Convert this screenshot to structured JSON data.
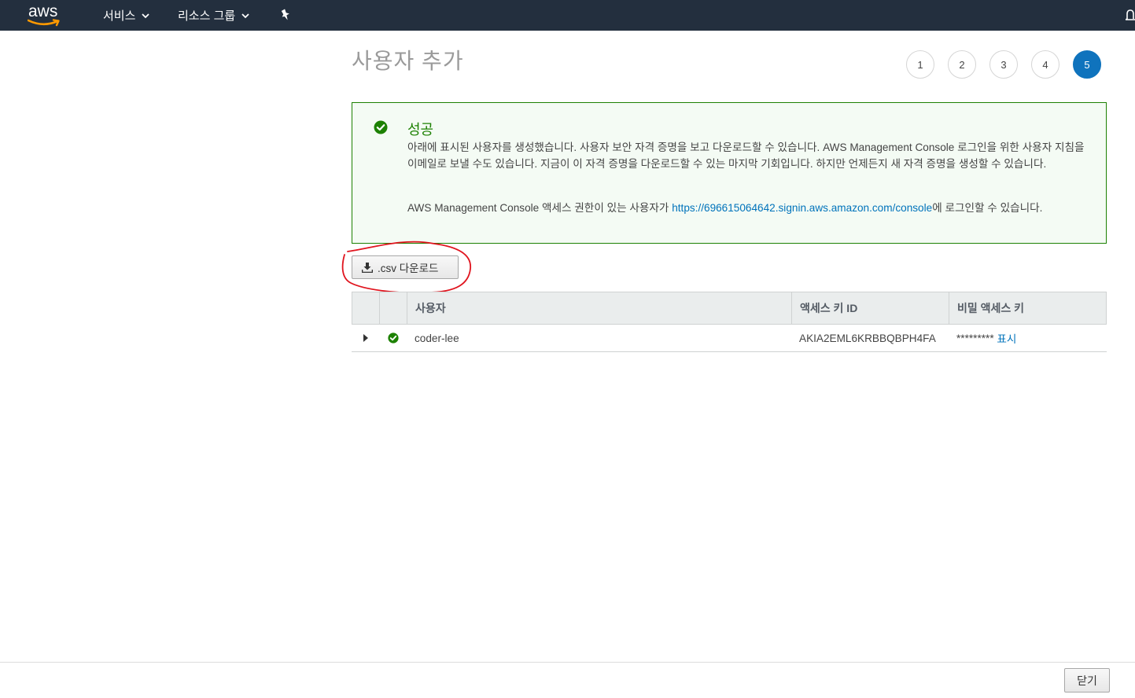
{
  "nav": {
    "logo_text": "aws",
    "services_label": "서비스",
    "resource_groups_label": "리소스 그룹",
    "icons": [
      "chevron-down-icon",
      "pin-icon",
      "bell-icon"
    ]
  },
  "page": {
    "title": "사용자 추가",
    "steps": [
      {
        "label": "1",
        "active": false
      },
      {
        "label": "2",
        "active": false
      },
      {
        "label": "3",
        "active": false
      },
      {
        "label": "4",
        "active": false
      },
      {
        "label": "5",
        "active": true
      }
    ]
  },
  "alert": {
    "title": "성공",
    "body": "아래에 표시된 사용자를 생성했습니다. 사용자 보안 자격 증명을 보고 다운로드할 수 있습니다. AWS Management Console 로그인을 위한 사용자 지침을 이메일로 보낼 수도 있습니다. 지금이 이 자격 증명을 다운로드할 수 있는 마지막 기회입니다. 하지만 언제든지 새 자격 증명을 생성할 수 있습니다.",
    "console_prefix": "AWS Management Console 액세스 권한이 있는 사용자가 ",
    "console_link": "https://696615064642.signin.aws.amazon.com/console",
    "console_suffix": "에 로그인할 수 있습니다."
  },
  "download": {
    "label": ".csv 다운로드"
  },
  "table": {
    "headers": {
      "user": "사용자",
      "access_key_id": "액세스 키 ID",
      "secret_key": "비밀 액세스 키"
    },
    "rows": [
      {
        "user": "coder-lee",
        "access_key_id": "AKIA2EML6KRBBQBPH4FA",
        "secret_masked": "*********",
        "show_label": "표시"
      }
    ]
  },
  "footer": {
    "close_label": "닫기"
  },
  "colors": {
    "nav_bg": "#232f3e",
    "success": "#1d8102",
    "active_step": "#0f73bd",
    "link": "#0073bb",
    "annotation": "#e0141e"
  }
}
